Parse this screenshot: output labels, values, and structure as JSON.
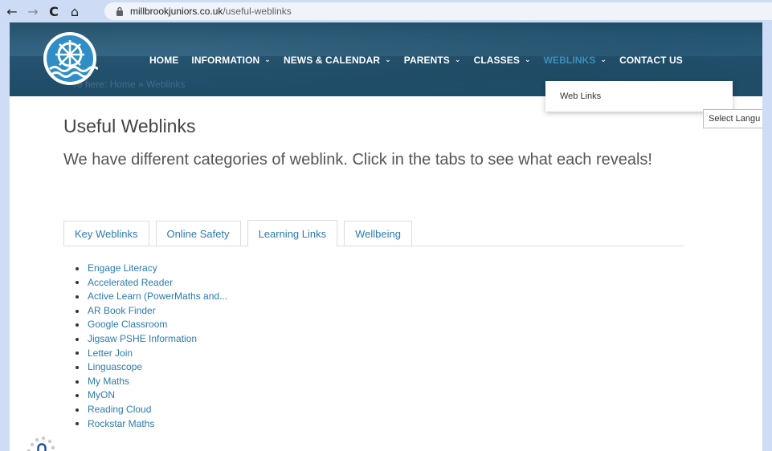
{
  "browser": {
    "url_host": "millbrookjuniors.co.uk",
    "url_path": "/useful-weblinks",
    "back_icon": "←",
    "forward_icon": "→",
    "reload_icon": "C",
    "home_icon": "⌂"
  },
  "header": {
    "nav": [
      {
        "label": "HOME",
        "dropdown": false
      },
      {
        "label": "INFORMATION",
        "dropdown": true
      },
      {
        "label": "NEWS & CALENDAR",
        "dropdown": true
      },
      {
        "label": "PARENTS",
        "dropdown": true
      },
      {
        "label": "CLASSES",
        "dropdown": true
      },
      {
        "label": "WEBLINKS",
        "dropdown": true,
        "active": true
      },
      {
        "label": "CONTACT US",
        "dropdown": false
      }
    ],
    "chevron": "v",
    "breadcrumb_prefix": "re here: ",
    "breadcrumb_home": "Home",
    "breadcrumb_sep": " » ",
    "breadcrumb_current": "Weblinks",
    "dropdown_item": "Web Links"
  },
  "language_select": "Select Langu",
  "main": {
    "title": "Useful Weblinks",
    "intro": "We have different categories of weblink. Click in the tabs to see what each reveals!",
    "tabs": [
      {
        "label": "Key Weblinks"
      },
      {
        "label": "Online Safety"
      },
      {
        "label": "Learning Links",
        "active": true
      },
      {
        "label": "Wellbeing"
      }
    ],
    "links": [
      "Engage Literacy",
      "Accelerated Reader",
      "Active Learn (PowerMaths and...",
      "AR Book Finder",
      "Google Classroom",
      "Jigsaw PSHE Information",
      "Letter Join",
      "Linguascope",
      "My Maths",
      "MyON",
      "Reading Cloud",
      "Rockstar Maths"
    ]
  },
  "colors": {
    "header": "#24566f",
    "active_nav": "#3d8fb7",
    "link": "#2b7bb0"
  }
}
